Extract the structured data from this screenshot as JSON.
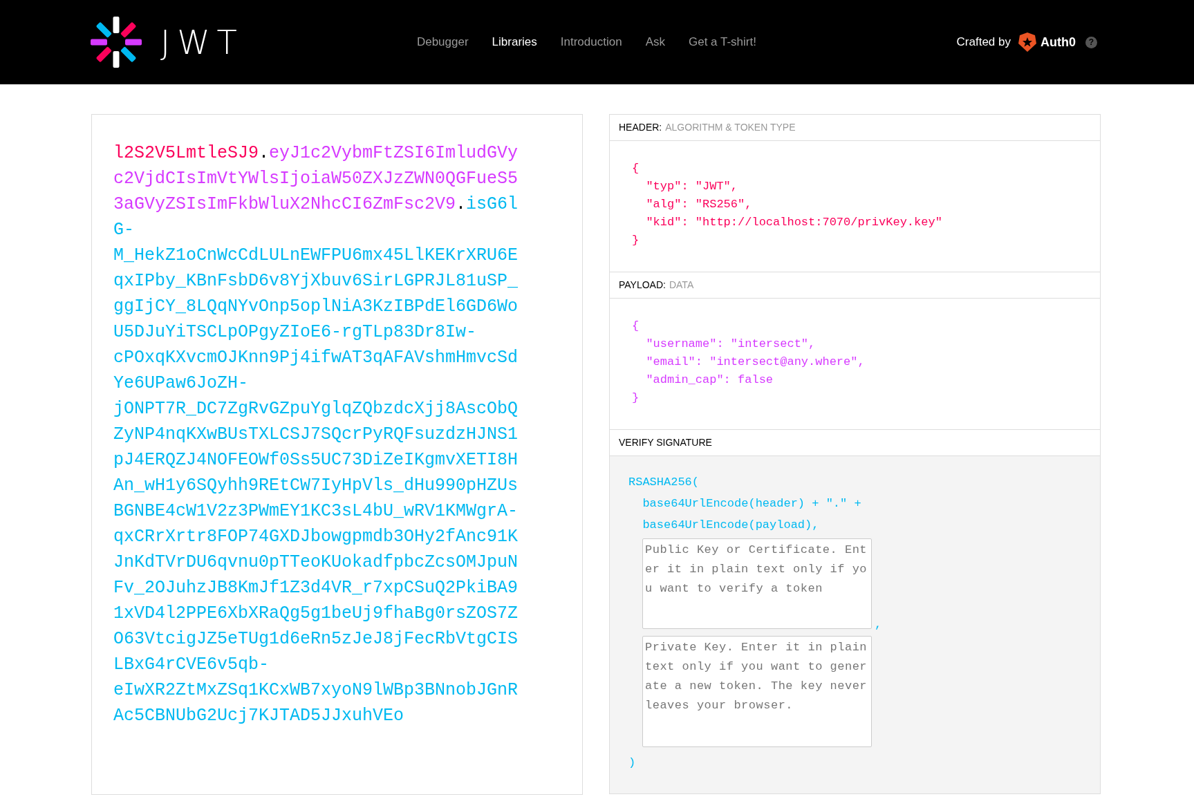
{
  "nav": {
    "logo_text": "JWT",
    "items": [
      {
        "label": "Debugger",
        "selected": false
      },
      {
        "label": "Libraries",
        "selected": true
      },
      {
        "label": "Introduction",
        "selected": false
      },
      {
        "label": "Ask",
        "selected": false
      },
      {
        "label": "Get a T-shirt!",
        "selected": false
      }
    ],
    "crafted_by": "Crafted by",
    "brand": "Auth0",
    "help": "?"
  },
  "encoded": {
    "parts": [
      {
        "kind": "header",
        "text": "l2S2V5LmtleSJ9"
      },
      {
        "kind": "dot",
        "text": "."
      },
      {
        "kind": "payload",
        "text": "eyJ1c2VybmFtZSI6ImludGVyc2VjdCIsImVtYWlsIjoiaW50ZXJzZWN0QGFueS53aGVyZSIsImFkbWluX2NhcCI6ZmFsc2V9"
      },
      {
        "kind": "dot",
        "text": "."
      },
      {
        "kind": "signature",
        "text": "isG6lG-M_HekZ1oCnWcCdLULnEWFPU6mx45LlKEKrXRU6EqxIPby_KBnFsbD6v8YjXbuv6SirLGPRJL81uSP_ggIjCY_8LQqNYvOnp5oplNiA3KzIBPdEl6GD6WoU5DJuYiTSCLpOPgyZIoE6-rgTLp83Dr8Iw-cPOxqKXvcmOJKnn9Pj4ifwAT3qAFAVshmHmvcSdYe6UPaw6JoZH-jONPT7R_DC7ZgRvGZpuYglqZQbzdcXjj8AscObQZyNP4nqKXwBUsTXLCSJ7SQcrPyRQFsuzdzHJNS1pJ4ERQZJ4NOFEOWf0Ss5UC73DiZeIKgmvXETI8HAn_wH1y6SQyhh9REtCW7IyHpVls_dHu990pHZUsBGNBE4cW1V2z3PWmEY1KC3sL4bU_wRV1KMWgrA-qxCRrXrtr8FOP74GXDJbowgpmdb3OHy2fAnc91KJnKdTVrDU6qvnu0pTTeoKUokadfpbcZcsOMJpuNFv_2OJuhzJB8KmJf1Z3d4VR_r7xpCSuQ2PkiBA91xVD4l2PPE6XbXRaQg5g1beUj9fhaBg0rsZOS7ZO63VtcigJZ5eTUg1d6eRn5zJeJ8jFecRbVtgCISLBxG4rCVE6v5qb-eIwXR2ZtMxZSq1KCxWB7xyoN9lWBp3BNnobJGnRAc5CBNUbG2Ucj7KJTAD5JJxuhVEo"
      }
    ]
  },
  "decoded": {
    "sections": [
      {
        "kind": "header",
        "title": "HEADER:",
        "subtitle": "ALGORITHM & TOKEN TYPE",
        "lines": [
          "{",
          "  \"typ\": \"JWT\",",
          "  \"alg\": \"RS256\",",
          "  \"kid\": \"http://localhost:7070/privKey.key\"",
          "}"
        ]
      },
      {
        "kind": "payload",
        "title": "PAYLOAD:",
        "subtitle": "DATA",
        "lines": [
          "{",
          "  \"username\": \"intersect\",",
          "  \"email\": \"intersect@any.where\",",
          "  \"admin_cap\": false",
          "}"
        ]
      }
    ],
    "verify": {
      "title": "VERIFY SIGNATURE",
      "lines": [
        "RSASHA256(",
        "  base64UrlEncode(header) + \".\" +",
        "  base64UrlEncode(payload),"
      ],
      "public_key": {
        "placeholder": "Public Key or Certificate. Enter it in plain text only if you want to verify a token"
      },
      "separator": ",",
      "private_key": {
        "placeholder": "Private Key. Enter it in plain text only if you want to generate a new token. The key never leaves your browser."
      },
      "closing": ")"
    }
  }
}
